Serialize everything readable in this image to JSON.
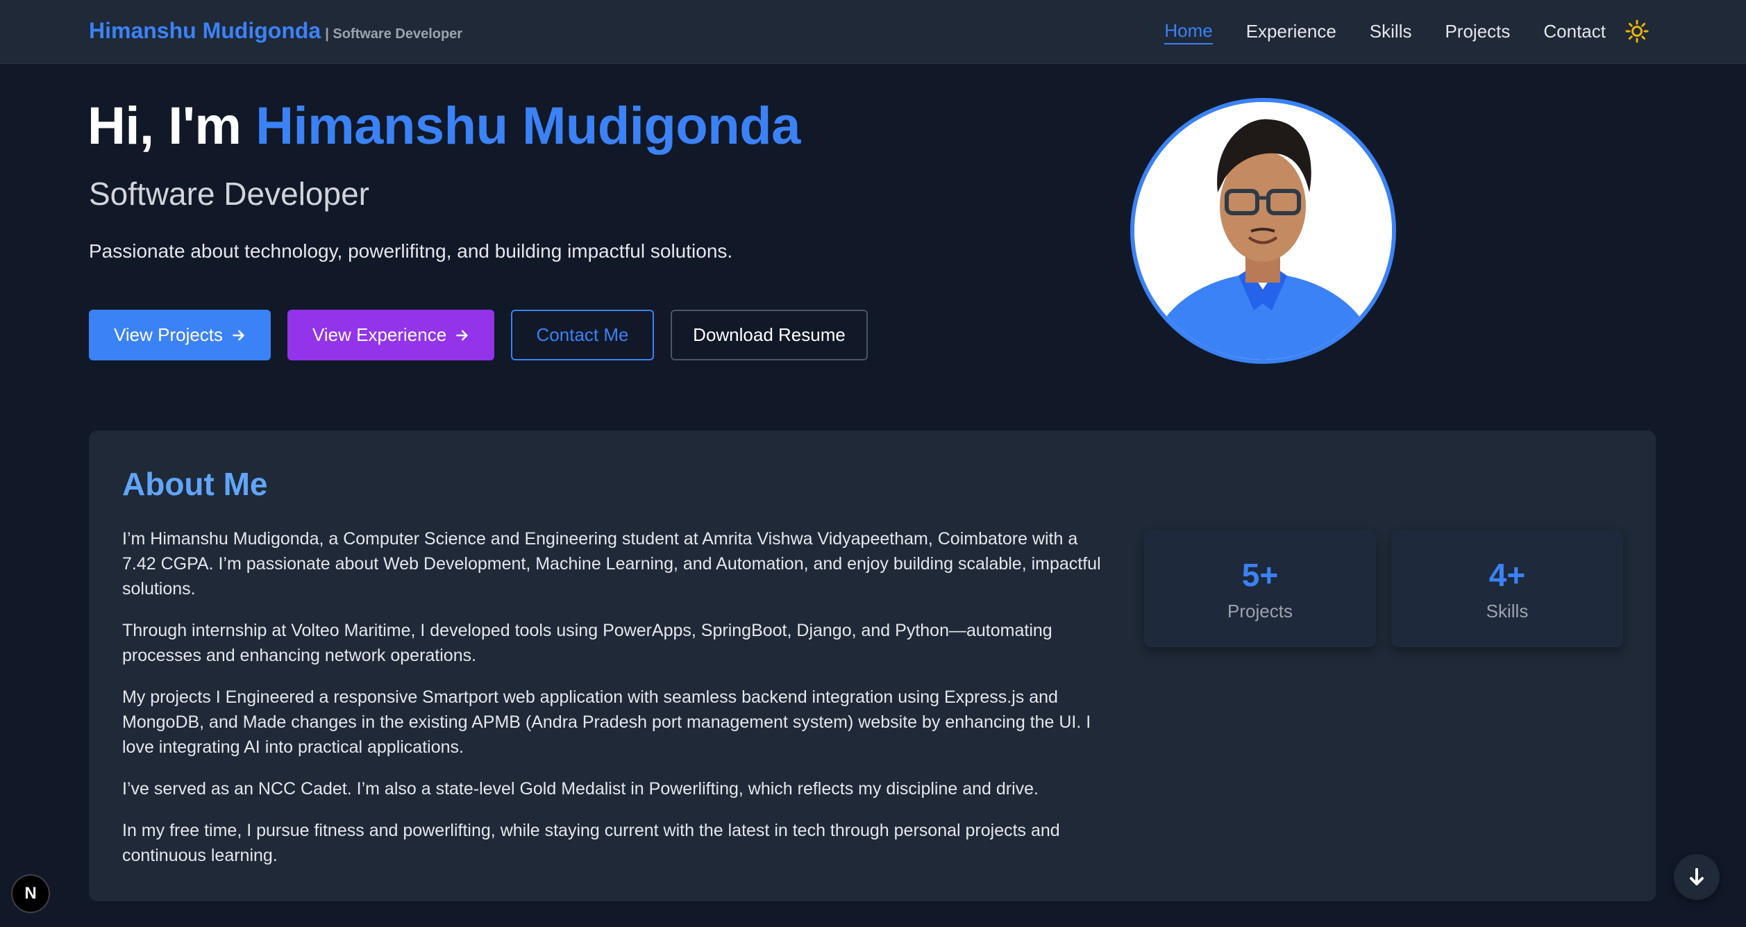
{
  "header": {
    "brand_name": "Himanshu Mudigonda",
    "brand_sub": "| Software Developer",
    "nav": [
      "Home",
      "Experience",
      "Skills",
      "Projects",
      "Contact"
    ],
    "active_nav": "Home",
    "theme_icon": "sun-icon"
  },
  "hero": {
    "greeting": "Hi, I'm ",
    "name": "Himanshu Mudigonda",
    "role": "Software Developer",
    "tagline": "Passionate about technology, powerlifitng, and building impactful solutions.",
    "buttons": {
      "projects": "View Projects",
      "experience": "View Experience",
      "contact": "Contact Me",
      "resume": "Download Resume"
    },
    "avatar_icon": "profile-photo"
  },
  "about": {
    "title": "About Me",
    "paragraphs": [
      "I’m Himanshu Mudigonda, a Computer Science and Engineering student at Amrita Vishwa Vidyapeetham, Coimbatore with a 7.42 CGPA. I’m passionate about Web Development, Machine Learning, and Automation, and enjoy building scalable, impactful solutions.",
      "Through internship at Volteo Maritime, I developed tools using PowerApps, SpringBoot, Django, and Python—automating processes and enhancing network operations.",
      "My projects I Engineered a responsive Smartport web application with seamless backend integration using Express.js and MongoDB, and Made changes in the existing APMB (Andra Pradesh port management system) website by enhancing the UI. I love integrating AI into practical applications.",
      "I’ve served as an NCC Cadet. I’m also a state-level Gold Medalist in Powerlifting, which reflects my discipline and drive.",
      "In my free time, I pursue fitness and powerlifting, while staying current with the latest in tech through personal projects and continuous learning."
    ],
    "stats": [
      {
        "value": "5+",
        "label": "Projects"
      },
      {
        "value": "4+",
        "label": "Skills"
      }
    ]
  },
  "floating": {
    "next_badge": "N",
    "scroll_icon": "arrow-down-icon"
  },
  "colors": {
    "background": "#111827",
    "surface": "#1f2937",
    "accent_blue": "#3b82f6",
    "accent_purple": "#9333ea",
    "sun": "#eab308"
  }
}
